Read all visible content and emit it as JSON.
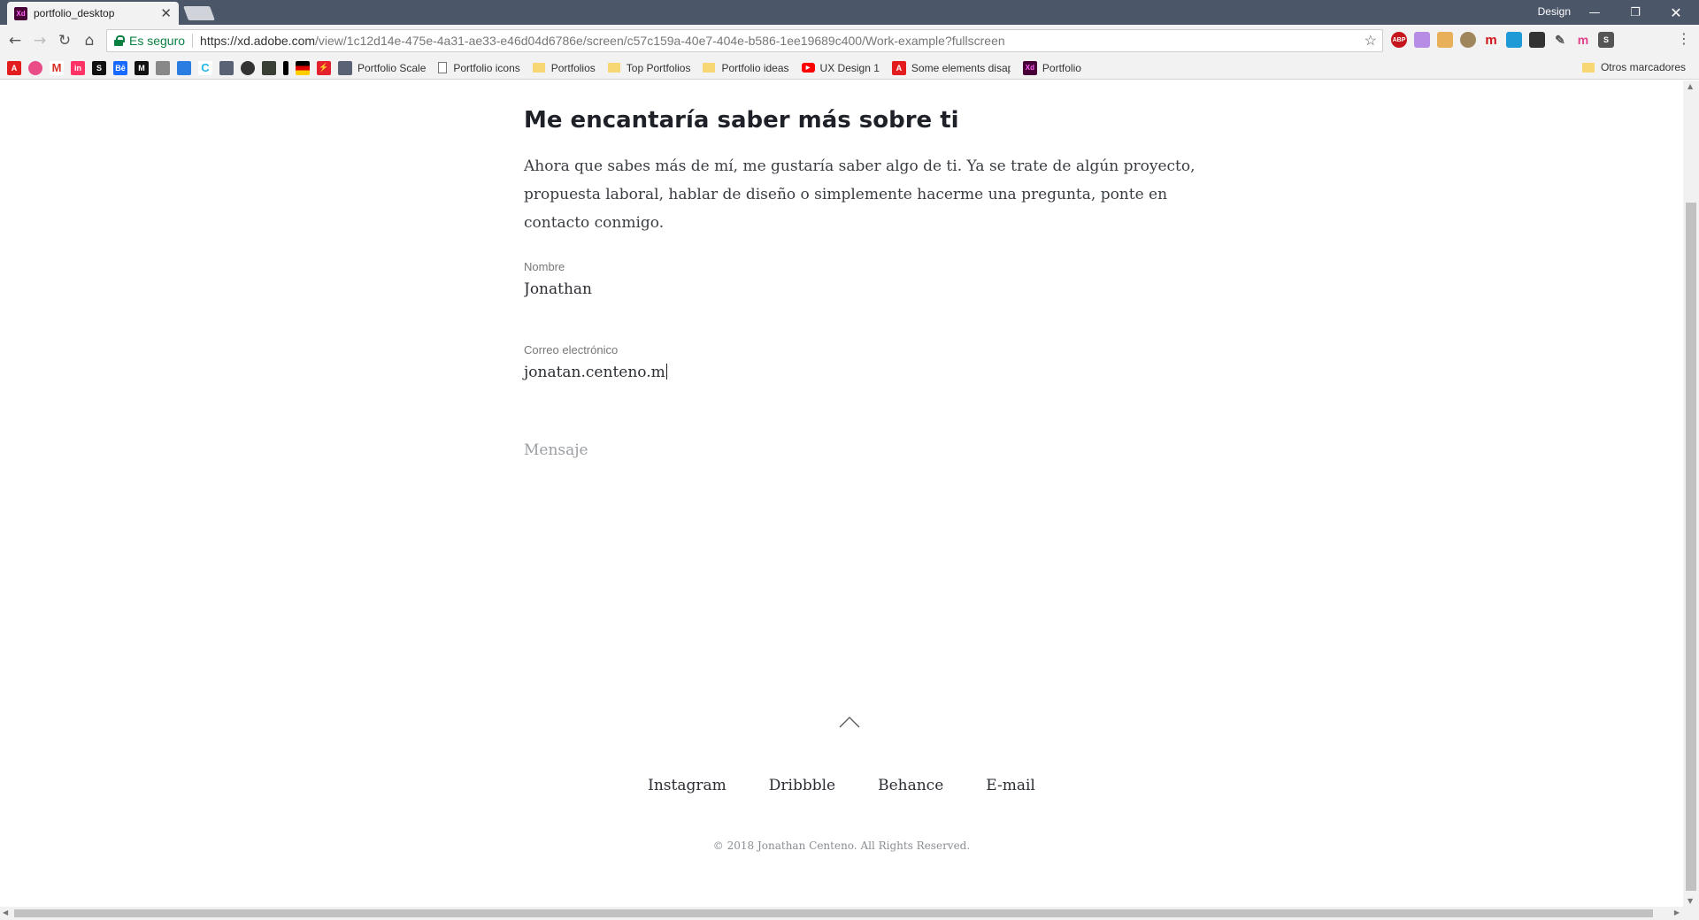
{
  "browser": {
    "tab_title": "portfolio_desktop",
    "tab_close": "✕",
    "profile": "Design",
    "secure_label": "Es seguro",
    "url_host": "https://xd.adobe.com",
    "url_path": "/view/1c12d14e-475e-4a31-ae33-e46d04d6786e/screen/c57c159a-40e7-404e-b586-1ee19689c400/Work-example?fullscreen",
    "bookmarks": [
      {
        "label": "Portfolio Scale",
        "icon": "list-icon"
      },
      {
        "label": "Portfolio icons",
        "icon": "page-icon"
      },
      {
        "label": "Portfolios",
        "icon": "folder-icon"
      },
      {
        "label": "Top Portfolios",
        "icon": "folder-icon"
      },
      {
        "label": "Portfolio ideas",
        "icon": "folder-icon"
      },
      {
        "label": "UX Design 1",
        "icon": "youtube-icon"
      },
      {
        "label": "Some elements disap",
        "icon": "adobe-icon"
      },
      {
        "label": "Portfolio",
        "icon": "xd-icon"
      }
    ],
    "other_bookmarks": "Otros marcadores",
    "colors": {
      "accent_green": "#0b8043",
      "frame": "#4b5668"
    }
  },
  "page": {
    "title": "Me encantaría saber más sobre ti",
    "intro": "Ahora que sabes más de mí, me gustaría saber algo de ti. Ya se trate de algún proyecto, propuesta laboral, hablar de diseño o simplemente hacerme una pregunta, ponte en contacto conmigo.",
    "form": {
      "name_label": "Nombre",
      "name_value": "Jonathan",
      "email_label": "Correo electrónico",
      "email_value": "jonatan.centeno.m",
      "message_placeholder": "Mensaje"
    },
    "footer": {
      "links": [
        "Instagram",
        "Dribbble",
        "Behance",
        "E-mail"
      ],
      "copyright": "© 2018 Jonathan Centeno. All Rights Reserved."
    }
  }
}
